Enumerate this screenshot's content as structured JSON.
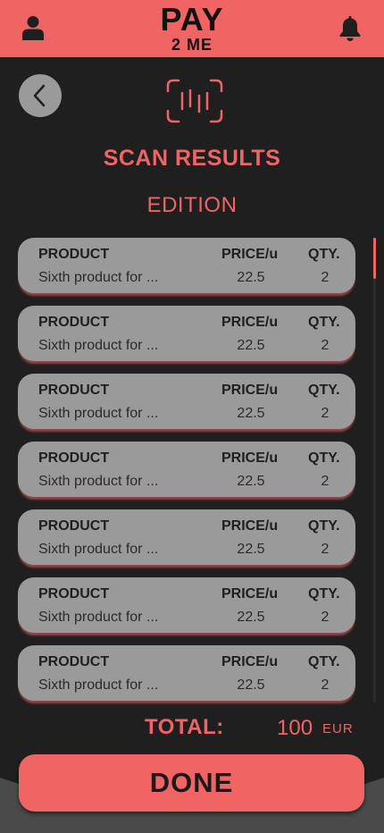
{
  "header": {
    "logo_line1": "PAY",
    "logo_line2": "2 ME"
  },
  "page": {
    "title": "SCAN RESULTS",
    "subtitle": "EDITION"
  },
  "columns": {
    "product": "PRODUCT",
    "price": "PRICE/u",
    "qty": "QTY."
  },
  "items": [
    {
      "name": "Sixth product for ...",
      "price": "22.5",
      "qty": "2"
    },
    {
      "name": "Sixth product for ...",
      "price": "22.5",
      "qty": "2"
    },
    {
      "name": "Sixth product for ...",
      "price": "22.5",
      "qty": "2"
    },
    {
      "name": "Sixth product for ...",
      "price": "22.5",
      "qty": "2"
    },
    {
      "name": "Sixth product for ...",
      "price": "22.5",
      "qty": "2"
    },
    {
      "name": "Sixth product for ...",
      "price": "22.5",
      "qty": "2"
    },
    {
      "name": "Sixth product for ...",
      "price": "22.5",
      "qty": "2"
    }
  ],
  "total": {
    "label": "TOTAL:",
    "value": "100",
    "currency": "EUR"
  },
  "done_label": "DONE",
  "icons": {
    "user": "user-icon",
    "bell": "bell-icon",
    "back": "chevron-left-icon",
    "scan": "barcode-scan-icon"
  },
  "colors": {
    "accent": "#f06464",
    "background": "#1f1f1f",
    "card": "#9a9a9a"
  }
}
